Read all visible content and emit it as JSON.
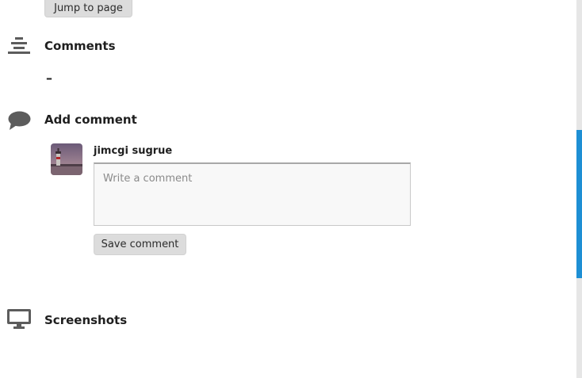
{
  "jump_button": {
    "label": "Jump to page"
  },
  "comments_section": {
    "title": "Comments",
    "icon": "list-lines-icon",
    "empty_value": "–"
  },
  "add_comment_section": {
    "title": "Add comment",
    "icon": "speech-bubble-icon",
    "user": {
      "name": "jimcgi sugrue",
      "avatar": "lighthouse-photo"
    },
    "input": {
      "placeholder": "Write a comment",
      "value": ""
    },
    "save_label": "Save comment"
  },
  "screenshots_section": {
    "title": "Screenshots",
    "icon": "monitor-icon"
  },
  "colors": {
    "icon_gray": "#5c5c5c",
    "button_bg": "#dcdcdc",
    "scrollbar_thumb": "#1e8fd4",
    "scrollbar_track": "#e6e6e6"
  }
}
